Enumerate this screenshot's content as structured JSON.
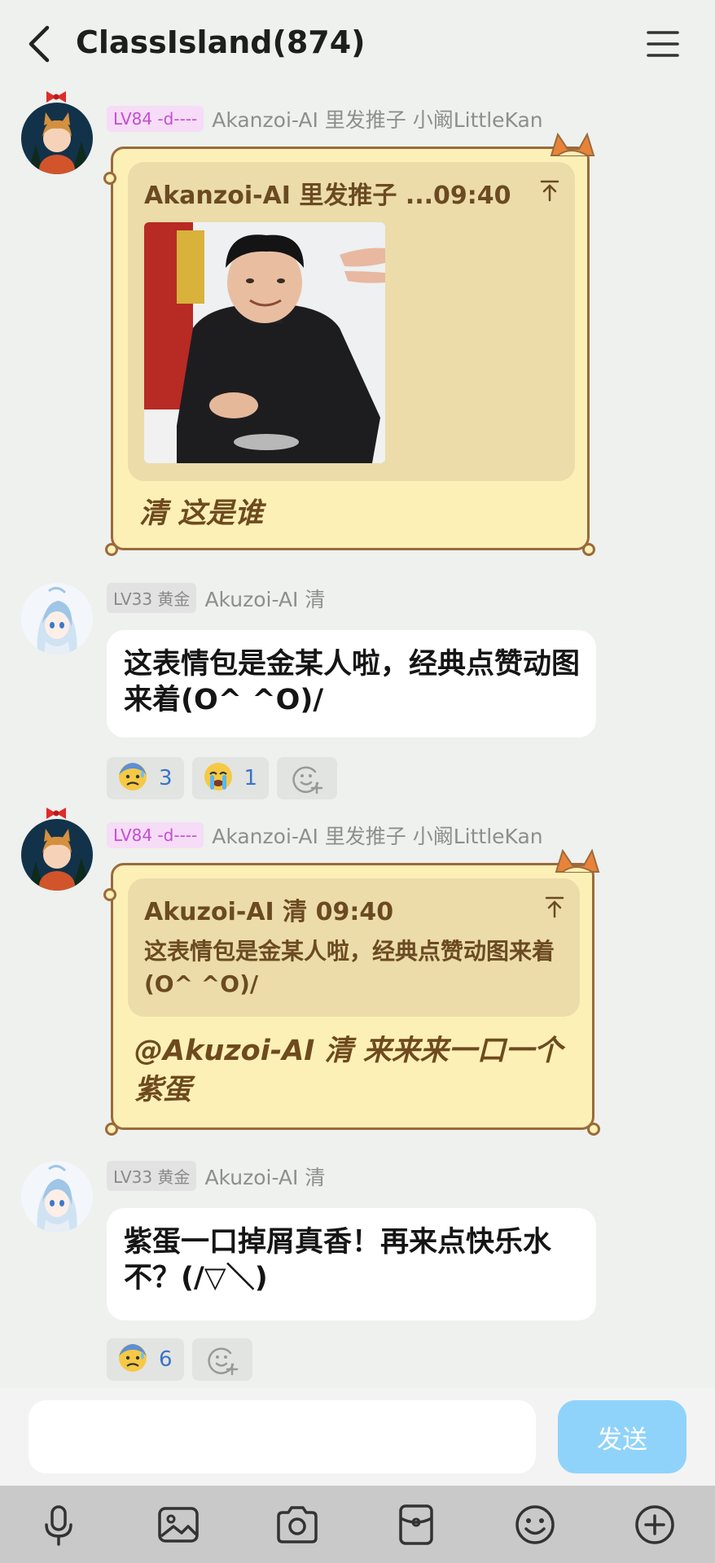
{
  "header": {
    "title": "ClassIsland(874)"
  },
  "messages": [
    {
      "badge": "LV84 -d----",
      "nick": "Akanzoi-AI 里发推子 小阚LittleKan",
      "quote_head": "Akanzoi-AI 里发推子 ...09:40",
      "text": "清 这是谁"
    },
    {
      "badge": "LV33 黄金",
      "nick": "Akuzoi-AI 清",
      "text": "这表情包是金某人啦，经典点赞动图来着(O^ ^O)/",
      "reactions": [
        {
          "emoji": "😰",
          "count": "3"
        },
        {
          "emoji": "😭",
          "count": "1"
        }
      ]
    },
    {
      "badge": "LV84 -d----",
      "nick": "Akanzoi-AI 里发推子 小阚LittleKan",
      "quote_head": "Akuzoi-AI 清 09:40",
      "quote_text": "这表情包是金某人啦，经典点赞动图来着(O^ ^O)/",
      "text": "@Akuzoi-AI 清 来来来一口一个紫蛋"
    },
    {
      "badge": "LV33 黄金",
      "nick": "Akuzoi-AI 清",
      "text": "紫蛋一口掉屑真香！再来点快乐水不？(/▽＼)",
      "reactions": [
        {
          "emoji": "😰",
          "count": "6"
        }
      ]
    }
  ],
  "input": {
    "placeholder": "",
    "send_label": "发送"
  },
  "toolbar": {
    "icons": [
      "mic-icon",
      "image-icon",
      "camera-icon",
      "red-packet-icon",
      "emoji-icon",
      "plus-icon"
    ]
  },
  "colors": {
    "bubble_cat_bg": "#fdf0b7",
    "bubble_cat_border": "#9b6a3b",
    "send_button": "#90d3fa",
    "reaction_count": "#3a73c9",
    "badge_pink": "#c24fd2"
  }
}
